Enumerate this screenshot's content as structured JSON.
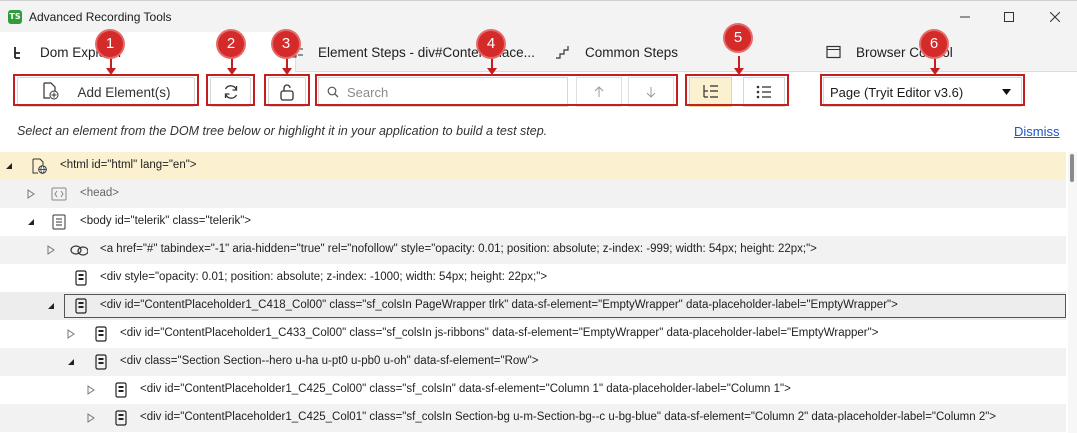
{
  "window": {
    "app_logo_text": "TS",
    "title": "Advanced Recording Tools"
  },
  "tabs": [
    {
      "label": "Dom Explorer",
      "active": true
    },
    {
      "label": "Element Steps - div#ContentPlace..."
    },
    {
      "label": "Common Steps"
    },
    {
      "label": "Browser Control"
    }
  ],
  "toolbar": {
    "add_element_label": "Add Element(s)",
    "search_placeholder": "Search",
    "page_select_value": "Page (Tryit Editor v3.6)"
  },
  "annotations": [
    "1",
    "2",
    "3",
    "4",
    "5",
    "6"
  ],
  "colors": {
    "annotation_red": "#c41f1f",
    "selected_row": "#fbf0cf",
    "link_blue": "#1a55c9"
  },
  "info": {
    "message": "Select an element from the DOM tree below or highlight it in your application to build a test step.",
    "dismiss_label": "Dismiss"
  },
  "tree": [
    {
      "text": "<html id=\"html\" lang=\"en\">",
      "icon": "page-globe-icon",
      "expanded": true,
      "selected": true
    },
    {
      "text": "<head>",
      "icon": "code-icon",
      "expanded": false,
      "dim": true
    },
    {
      "text": "<body id=\"telerik\" class=\"telerik\">",
      "icon": "document-icon",
      "expanded": true
    },
    {
      "text": "<a href=\"#\" tabindex=\"-1\" aria-hidden=\"true\" rel=\"nofollow\" style=\"opacity: 0.01; position: absolute; z-index: -999; width: 54px; height: 22px;\">",
      "icon": "link-icon",
      "expanded": false
    },
    {
      "text": "<div style=\"opacity: 0.01; position: absolute; z-index: -1000; width: 54px; height: 22px;\">",
      "icon": "element-icon"
    },
    {
      "text": "<div id=\"ContentPlaceholder1_C418_Col00\" class=\"sf_colsIn PageWrapper tlrk\" data-sf-element=\"EmptyWrapper\" data-placeholder-label=\"EmptyWrapper\">",
      "icon": "element-icon",
      "expanded": true,
      "focused": true
    },
    {
      "text": "<div id=\"ContentPlaceholder1_C433_Col00\" class=\"sf_colsIn js-ribbons\" data-sf-element=\"EmptyWrapper\" data-placeholder-label=\"EmptyWrapper\">",
      "icon": "element-icon",
      "expanded": false
    },
    {
      "text": "<div class=\"Section Section--hero u-ha u-pt0 u-pb0 u-oh\" data-sf-element=\"Row\">",
      "icon": "element-icon",
      "expanded": true
    },
    {
      "text": "<div id=\"ContentPlaceholder1_C425_Col00\" class=\"sf_colsIn\" data-sf-element=\"Column 1\" data-placeholder-label=\"Column 1\">",
      "icon": "element-icon",
      "expanded": false
    },
    {
      "text": "<div id=\"ContentPlaceholder1_C425_Col01\" class=\"sf_colsIn Section-bg u-m-Section-bg--c u-bg-blue\" data-sf-element=\"Column 2\" data-placeholder-label=\"Column 2\">",
      "icon": "element-icon",
      "expanded": false
    }
  ]
}
